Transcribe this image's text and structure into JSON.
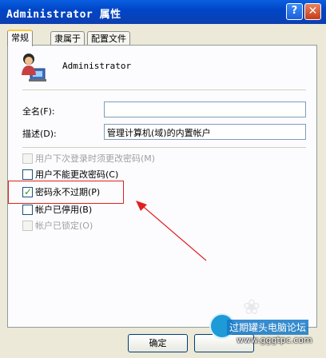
{
  "window": {
    "title": "Administrator 属性",
    "help_label": "?",
    "close_label": "✕"
  },
  "tabs": [
    {
      "label": "常规",
      "active": true
    },
    {
      "label": "隶属于",
      "active": false
    },
    {
      "label": "配置文件",
      "active": false
    }
  ],
  "user": {
    "name": "Administrator"
  },
  "fields": {
    "fullname_label": "全名(F):",
    "fullname_value": "",
    "desc_label": "描述(D):",
    "desc_value": "管理计算机(域)的内置帐户"
  },
  "checkboxes": [
    {
      "label": "用户下次登录时须更改密码(M)",
      "checked": false,
      "disabled": true
    },
    {
      "label": "用户不能更改密码(C)",
      "checked": false,
      "disabled": false
    },
    {
      "label": "密码永不过期(P)",
      "checked": true,
      "disabled": false
    },
    {
      "label": "帐户已停用(B)",
      "checked": false,
      "disabled": false
    },
    {
      "label": "帐户已锁定(O)",
      "checked": false,
      "disabled": true
    }
  ],
  "buttons": {
    "ok_label": "确定"
  },
  "watermark": {
    "name": "过期罐头电脑论坛",
    "url": "www.gggtpc.com"
  },
  "annotation_color": "#e02020"
}
